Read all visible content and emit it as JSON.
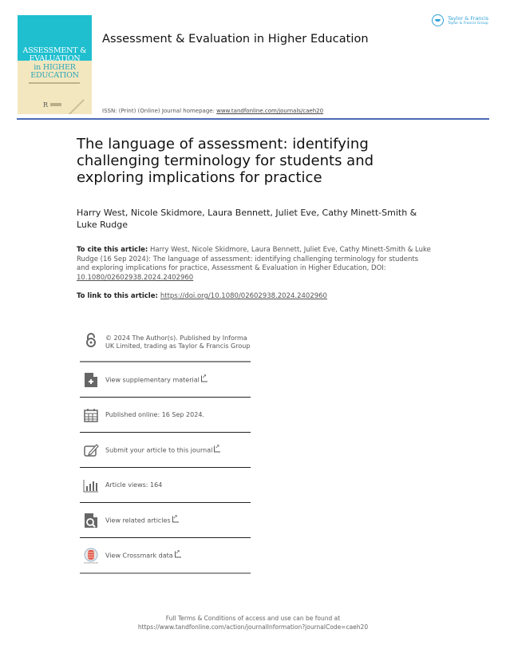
{
  "header": {
    "cover": {
      "title_line1": "ASSESSMENT &",
      "title_line2": "EVALUATION",
      "title_line3": "in HIGHER",
      "title_line4": "EDUCATION",
      "publisher_mark": "R"
    },
    "journal_title": "Assessment & Evaluation in Higher Education",
    "issn_text": "ISSN: (Print) (Online) Journal homepage: ",
    "homepage_link": "www.tandfonline.com/journals/caeh20",
    "publisher_logo": {
      "name": "Taylor & Francis",
      "subtitle": "Taylor & Francis Group"
    }
  },
  "article": {
    "title": "The language of assessment: identifying challenging terminology for students and exploring implications for practice",
    "authors": "Harry West, Nicole Skidmore, Laura Bennett, Juliet Eve, Cathy Minett-Smith & Luke Rudge",
    "cite_label": "To cite this article:",
    "cite_text": " Harry West, Nicole Skidmore, Laura Bennett, Juliet Eve, Cathy Minett-Smith & Luke Rudge (16 Sep 2024): The language of assessment: identifying challenging terminology for students and exploring implications for practice, Assessment & Evaluation in Higher Education, DOI: ",
    "cite_doi": "10.1080/02602938.2024.2402960",
    "link_label": "To link to this article: ",
    "link_url": "https://doi.org/10.1080/02602938.2024.2402960"
  },
  "panel": {
    "copyright": "© 2024 The Author(s). Published by Informa UK Limited, trading as Taylor & Francis Group",
    "supplementary": "View supplementary material",
    "published": "Published online: 16 Sep 2024.",
    "submit": "Submit your article to this journal",
    "views": "Article views: 164",
    "related": "View related articles",
    "crossmark": "View Crossmark data"
  },
  "footer": {
    "line1": "Full Terms & Conditions of access and use can be found at",
    "line2": "https://www.tandfonline.com/action/journalInformation?journalCode=caeh20"
  }
}
